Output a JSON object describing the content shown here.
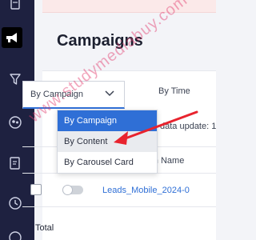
{
  "sidebar": {
    "icons": [
      {
        "name": "document-icon"
      },
      {
        "name": "megaphone-icon",
        "active": true
      },
      {
        "name": "funnel-icon"
      },
      {
        "name": "audience-icon"
      },
      {
        "name": "report-icon"
      },
      {
        "name": "clock-icon"
      },
      {
        "name": "history-icon"
      }
    ]
  },
  "page": {
    "title": "Campaigns"
  },
  "filters": {
    "group_by": {
      "value": "By Campaign",
      "options": [
        {
          "label": "By Campaign",
          "state": "selected"
        },
        {
          "label": "By Content",
          "state": "hover"
        },
        {
          "label": "By Carousel Card",
          "state": "normal"
        }
      ]
    },
    "time": {
      "value": "By Time"
    }
  },
  "info": {
    "data_update": "data update: 1"
  },
  "table": {
    "header": {
      "campaign_name": "paign Name"
    },
    "rows": [
      {
        "campaign": "Leads_Mobile_2024-0",
        "active": false
      }
    ],
    "footer": {
      "total_label": "Total"
    }
  },
  "watermark": {
    "text": "www.studymediabuy.com"
  },
  "colors": {
    "accent": "#2f6fd6",
    "sidebar_bg": "#1e2140",
    "annotation_arrow": "#e8232e",
    "alert_strip": "#fbe9e9"
  }
}
